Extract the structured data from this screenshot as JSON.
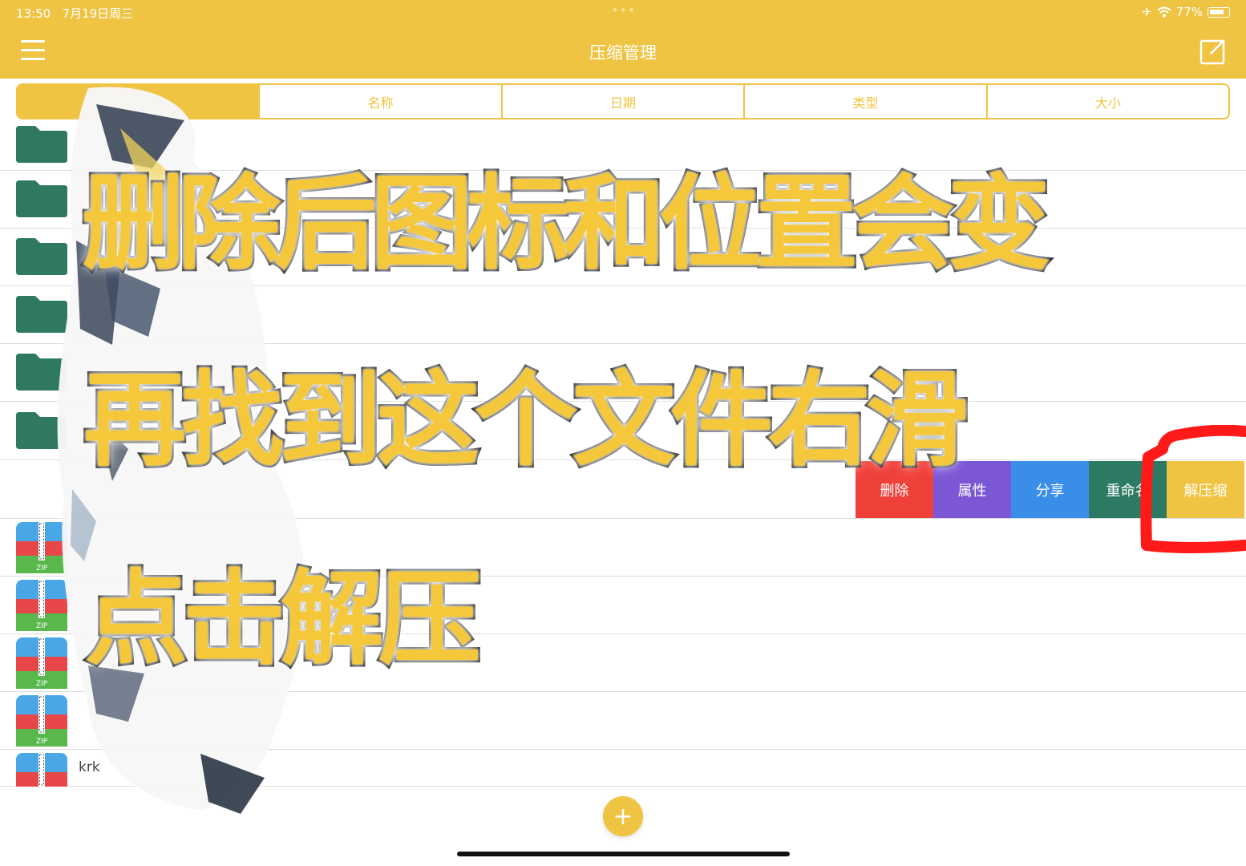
{
  "status": {
    "time": "13:50",
    "date": "7月19日周三",
    "battery": "77%",
    "dots": "•••"
  },
  "header": {
    "title": "压缩管理"
  },
  "sort_tabs": [
    "",
    "名称",
    "日期",
    "类型",
    "大小"
  ],
  "rows": {
    "last_label": "krk"
  },
  "swipe_actions": [
    {
      "label": "删除",
      "color": "#f0403a"
    },
    {
      "label": "属性",
      "color": "#7b57d6"
    },
    {
      "label": "分享",
      "color": "#3b8ee8"
    },
    {
      "label": "重命名",
      "color": "#2c7a63"
    },
    {
      "label": "解压缩",
      "color": "#efc443"
    }
  ],
  "captions": {
    "line1": "删除后图标和位置会变",
    "line2": "再找到这个文件右滑",
    "line3": "点击解压"
  },
  "fab": {
    "label": "+"
  },
  "colors": {
    "accent": "#efc443",
    "folder": "#2f7a5e"
  }
}
